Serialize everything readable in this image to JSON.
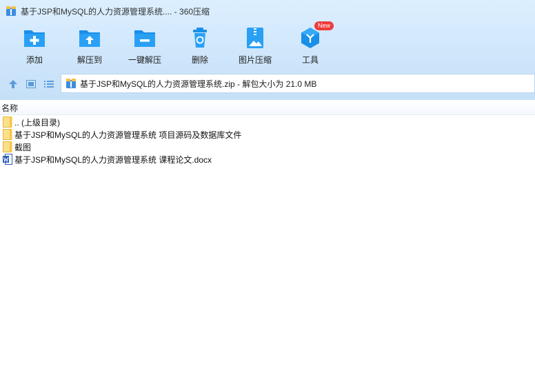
{
  "window": {
    "title": "基于JSP和MySQL的人力资源管理系统.... - 360压缩"
  },
  "toolbar": {
    "items": [
      {
        "label": "添加",
        "icon": "add-folder-icon"
      },
      {
        "label": "解压到",
        "icon": "extract-to-icon"
      },
      {
        "label": "一键解压",
        "icon": "one-click-extract-icon"
      },
      {
        "label": "删除",
        "icon": "recycle-bin-icon"
      },
      {
        "label": "图片压缩",
        "icon": "image-compress-icon"
      },
      {
        "label": "工具",
        "icon": "tools-icon",
        "badge": "New"
      }
    ]
  },
  "address": {
    "text": "基于JSP和MySQL的人力资源管理系统.zip - 解包大小为 21.0 MB"
  },
  "list": {
    "column_name": "名称",
    "rows": [
      {
        "name": ".. (上级目录)",
        "icon": "folder-icon"
      },
      {
        "name": "基于JSP和MySQL的人力资源管理系统 项目源码及数据库文件",
        "icon": "folder-icon"
      },
      {
        "name": "截图",
        "icon": "folder-icon"
      },
      {
        "name": "基于JSP和MySQL的人力资源管理系统 课程论文.docx",
        "icon": "word-doc-icon"
      }
    ]
  },
  "colors": {
    "accent": "#1a90e8",
    "folder": "#f7c748",
    "badge": "#ef3b3b",
    "word": "#2a5cb8"
  }
}
